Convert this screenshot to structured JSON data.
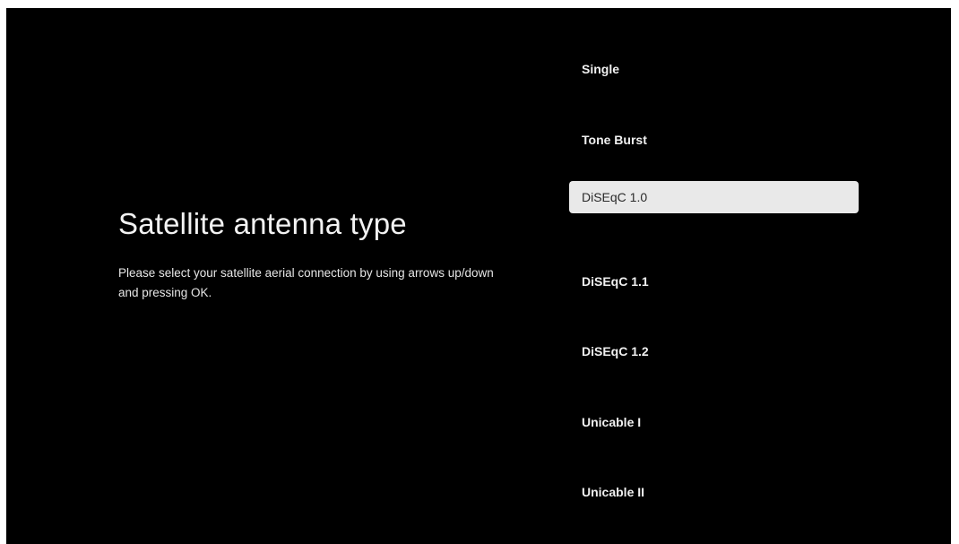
{
  "title": "Satellite antenna type",
  "description": "Please select your satellite aerial connection by using arrows up/down and pressing OK.",
  "options": [
    {
      "label": "Single",
      "selected": false
    },
    {
      "label": "Tone Burst",
      "selected": false
    },
    {
      "label": "DiSEqC 1.0",
      "selected": true
    },
    {
      "label": "DiSEqC 1.1",
      "selected": false
    },
    {
      "label": "DiSEqC 1.2",
      "selected": false
    },
    {
      "label": "Unicable I",
      "selected": false
    },
    {
      "label": "Unicable II",
      "selected": false
    }
  ],
  "colors": {
    "background": "#000000",
    "selected_background": "#e9e9e9",
    "selected_text": "#2a2a2a",
    "text": "#f0f0f0"
  }
}
